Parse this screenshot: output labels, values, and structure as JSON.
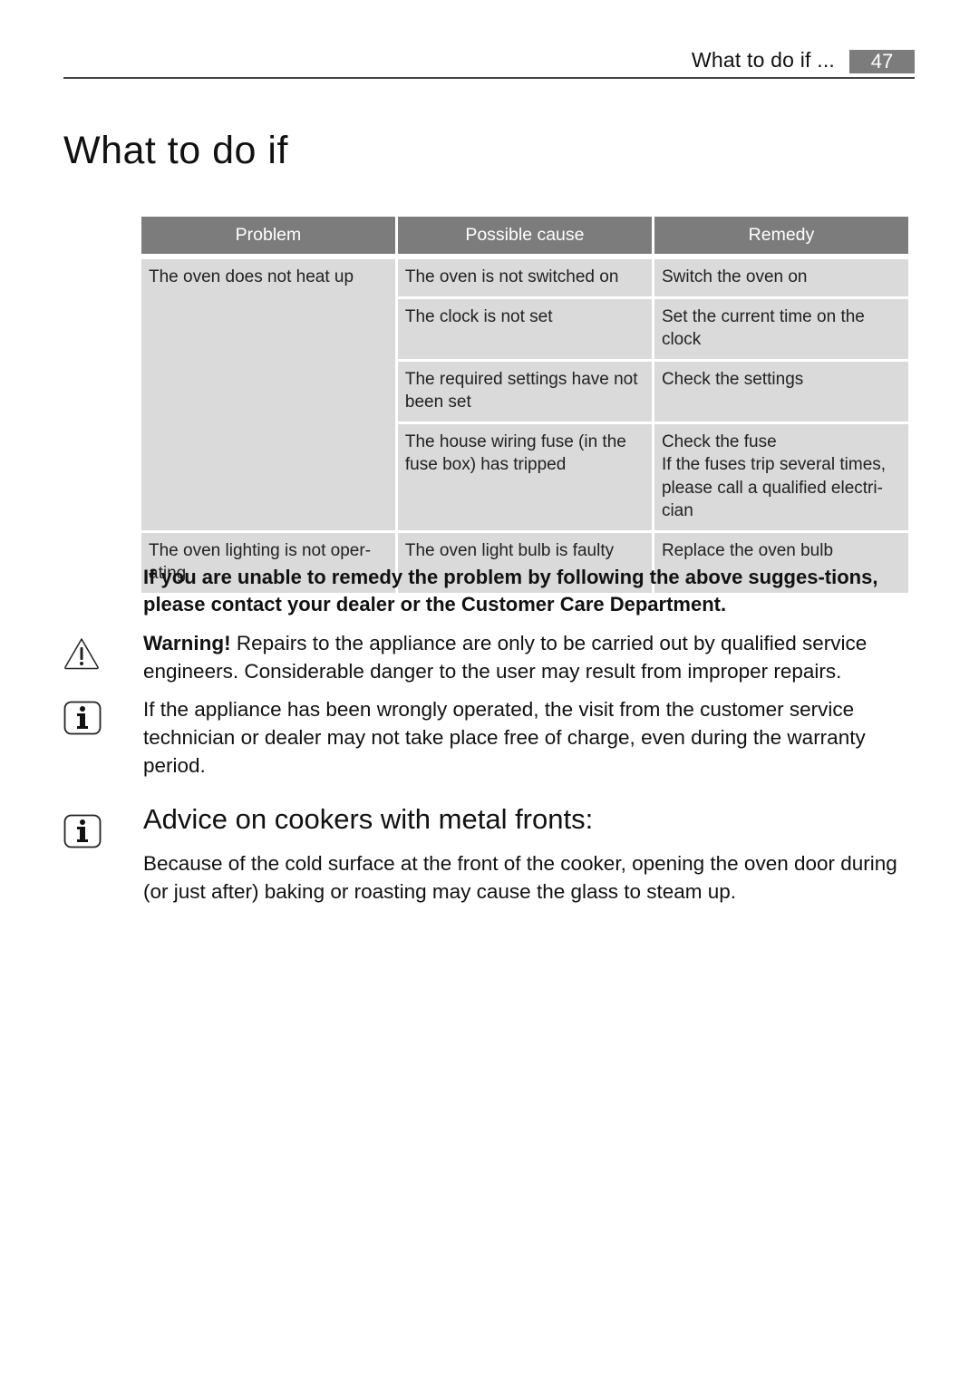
{
  "header": {
    "running_title": "What to do if ...",
    "page_number": "47"
  },
  "page_title": "What to do if",
  "table": {
    "columns": [
      "Problem",
      "Possible cause",
      "Remedy"
    ],
    "groups": [
      {
        "problem": "The oven does not heat up",
        "rows": [
          {
            "cause": "The oven is not switched on",
            "remedy": "Switch the oven on"
          },
          {
            "cause": "The clock is not set",
            "remedy": "Set the current time on the clock"
          },
          {
            "cause": "The required settings have not been set",
            "remedy": "Check the settings"
          },
          {
            "cause": "The house wiring fuse (in the fuse box) has tripped",
            "remedy": "Check the fuse",
            "remedy_extra": "If the fuses trip several times, please call a qualified electri-cian"
          }
        ]
      },
      {
        "problem": "The oven lighting is not oper-ating",
        "rows": [
          {
            "cause": "The oven light bulb is faulty",
            "remedy": "Replace the oven bulb"
          }
        ]
      }
    ]
  },
  "bold_note": "If you are unable to remedy the problem by following the above sugges-tions, please contact your dealer or the Customer Care Department.",
  "warning": {
    "icon": "warning-triangle-icon",
    "label": "Warning!",
    "text": " Repairs to the appliance are only to be carried out by qualified service engineers. Considerable danger to the user may result from improper repairs."
  },
  "info_note": {
    "icon": "info-icon",
    "text": "If the appliance has been wrongly operated, the visit from the customer service technician or dealer may not take place free of charge, even during the warranty period."
  },
  "advice": {
    "icon": "info-icon",
    "heading": "Advice on cookers with metal fronts:",
    "text": "Because of the cold surface at the front of the cooker, opening the oven door during (or just after) baking or roasting may cause the glass to steam up."
  },
  "colors": {
    "header_fill": "#7c7c7c",
    "cell_fill": "#dadada",
    "text": "#111111"
  }
}
